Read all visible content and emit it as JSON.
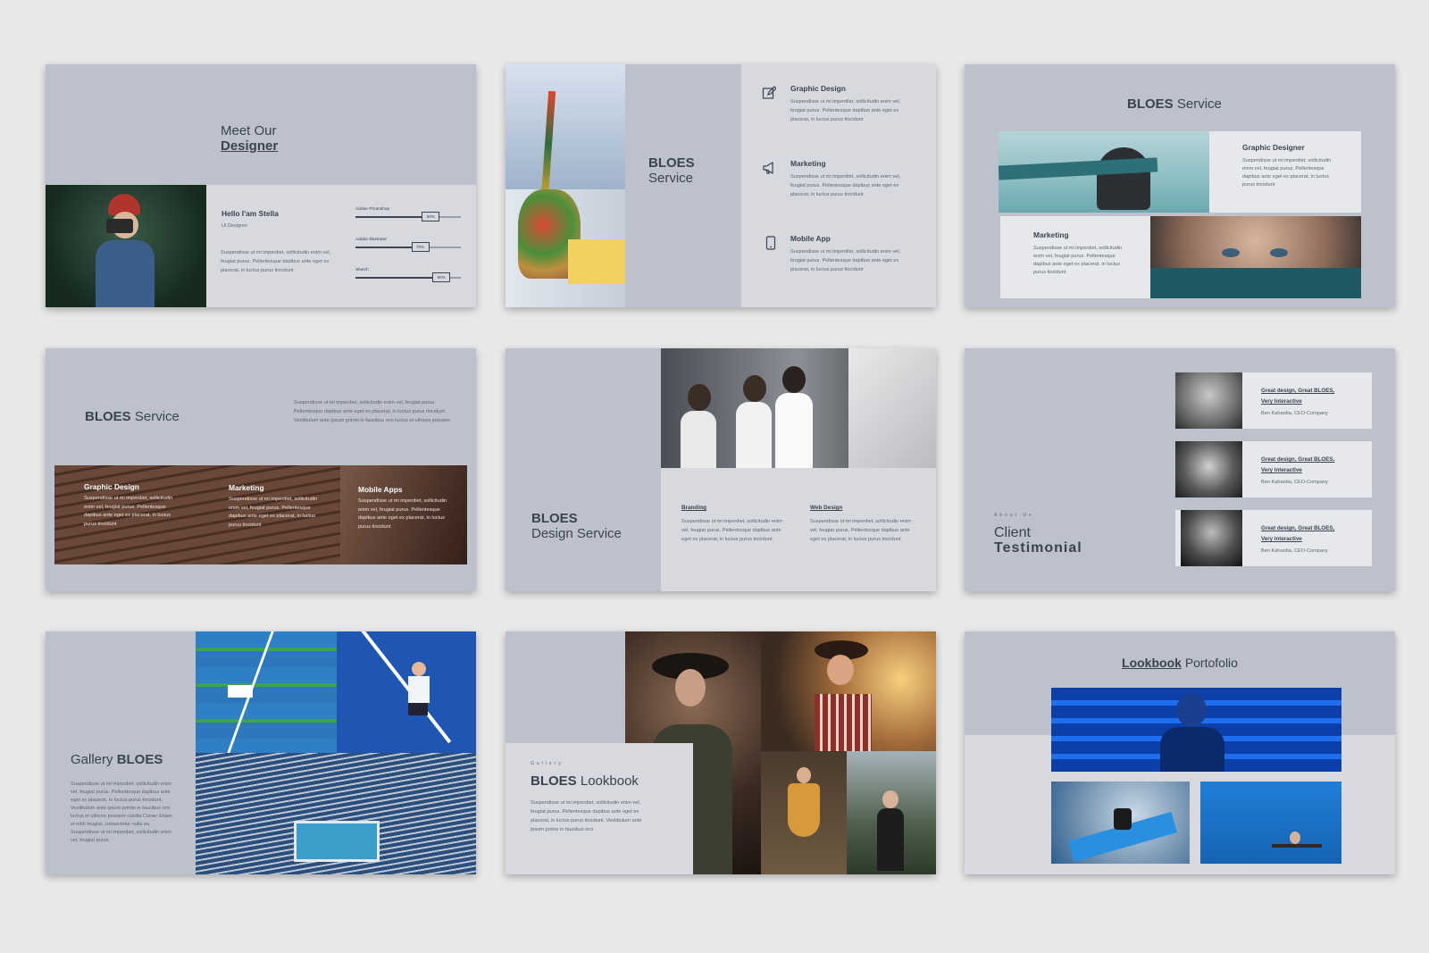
{
  "colors": {
    "slide_bg": "#bcc1cb",
    "panel_light": "#d7d9df",
    "text_dark": "#3d4250",
    "page_bg": "#e8e8e8"
  },
  "slide1": {
    "title_line1": "Meet Our",
    "title_line2": "Designer",
    "name": "Hello I'am Stella",
    "role": "Ui Designer",
    "desc": "Suspendisse ut mi imperdiet, sollicitudin enim vel, feugiat purus. Pellentesque dapibus ante eget ex placerat, in luctus purus tincidunt",
    "skills": [
      {
        "label": "Adobe Photoshop",
        "value": "80%",
        "fraction": 0.8
      },
      {
        "label": "Adobe Illustrator",
        "value": "70%",
        "fraction": 0.7
      },
      {
        "label": "Sketch",
        "value": "90%",
        "fraction": 0.9
      }
    ]
  },
  "slide2": {
    "title_line1": "BLOES",
    "title_line2": "Service",
    "items": [
      {
        "icon": "pencil-icon",
        "title": "Graphic Design",
        "desc": "Suspendisse ut mi imperdiet, sollicitudin enim vel, feugiat purus. Pellentesque dapibus ante eget ex placerat, in luctus purus tincidunt"
      },
      {
        "icon": "megaphone-icon",
        "title": "Marketing",
        "desc": "Suspendisse ut mi imperdiet, sollicitudin enim vel, feugiat purus. Pellentesque dapibus ante eget ex placerat, in luctus purus tincidunt"
      },
      {
        "icon": "smartphone-icon",
        "title": "Mobile App",
        "desc": "Suspendisse ut mi imperdiet, sollicitudin enim vel, feugiat purus. Pellentesque dapibus ante eget ex placerat, in luctus purus tincidunt"
      }
    ]
  },
  "slide3": {
    "title_bold": "BLOES",
    "title_rest": "Service",
    "box1_title": "Graphic Designer",
    "box1_desc": "Suspendisse ut mi imperdiet, sollicitudin enim vel, feugiat purus. Pellentesque dapibus ante eget ex placerat, in luctus purus tincidunt",
    "box2_title": "Marketing",
    "box2_desc": "Suspendisse ut mi imperdiet, sollicitudin enim vel, feugiat purus. Pellentesque dapibus ante eget ex placerat, in luctus purus tincidunt"
  },
  "slide4": {
    "title_bold": "BLOES",
    "title_rest": "Service",
    "desc": "Suspendisse ut mi imperdiet, sollicitudin enim vel, feugiat purus. Pellentesque dapibus ante eget ex placerat, in luctus purus tincidunt. Vestibulum ante ipsum primis in faucibus orci luctus et ultrices posuere",
    "items": [
      {
        "title": "Graphic Design",
        "desc": "Suspendisse ut mi imperdiet, sollicitudin enim vel, feugiat purus. Pellentesque dapibus ante eget ex placerat, in luctus purus tincidunt"
      },
      {
        "title": "Marketing",
        "desc": "Suspendisse ut mi imperdiet, sollicitudin enim vel, feugiat purus. Pellentesque dapibus ante eget ex placerat, in luctus purus tincidunt"
      },
      {
        "title": "Mobile Apps",
        "desc": "Suspendisse ut mi imperdiet, sollicitudin enim vel, feugiat purus. Pellentesque dapibus ante eget ex placerat, in luctus purus tincidunt"
      }
    ]
  },
  "slide5": {
    "title_line1": "BLOES",
    "title_line2": "Design Service",
    "items": [
      {
        "title": "Branding",
        "desc": "Suspendisse ut mi imperdiet, sollicitudin enim vel, feugiat purus. Pellentesque dapibus ante eget ex placerat, in luctus purus tincidunt"
      },
      {
        "title": "Web Design",
        "desc": "Suspendisse ut mi imperdiet, sollicitudin enim vel, feugiat purus. Pellentesque dapibus ante eget ex placerat, in luctus purus tincidunt"
      }
    ]
  },
  "slide6": {
    "kicker": "About Us",
    "title_line1": "Client",
    "title_line2": "Testimonial",
    "testimonials": [
      {
        "quote_line1": "Great design, Great BLOES,",
        "quote_line2": "Very Interactive",
        "author": "Ben Kahardia, CEO-Company"
      },
      {
        "quote_line1": "Great design, Great BLOES,",
        "quote_line2": "Very Interactive",
        "author": "Ben Kahardia, CEO-Company"
      },
      {
        "quote_line1": "Great design, Great BLOES,",
        "quote_line2": "Very Interactive",
        "author": "Ben Kahardia, CEO-Company"
      }
    ]
  },
  "slide7": {
    "title_rest": "Gallery",
    "title_bold": "BLOES",
    "desc": "Suspendisse ut mi imperdiet, sollicitudin enim vel, feugiat purus. Pellentesque dapibus ante eget ex placerat, in luctus purus tincidunt. Vestibulum ante ipsum primis in faucibus orci luctus et ultrices posuere cubilia Curae; Etiam et nibh feugiat, consectetur nulla eu. Suspendisse ut mi imperdiet, sollicitudin enim vel, feugiat purus"
  },
  "slide8": {
    "kicker": "Gallery",
    "title_bold": "BLOES",
    "title_rest": "Lookbook",
    "desc": "Suspendisse ut mi imperdiet, sollicitudin enim vel, feugiat purus. Pellentesque dapibus ante eget ex placerat, in luctus purus tincidunt. Vestibulum ante ipsum primis in faucibus orci"
  },
  "slide9": {
    "title_bold": "Lookbook",
    "title_rest": "Portofolio"
  }
}
